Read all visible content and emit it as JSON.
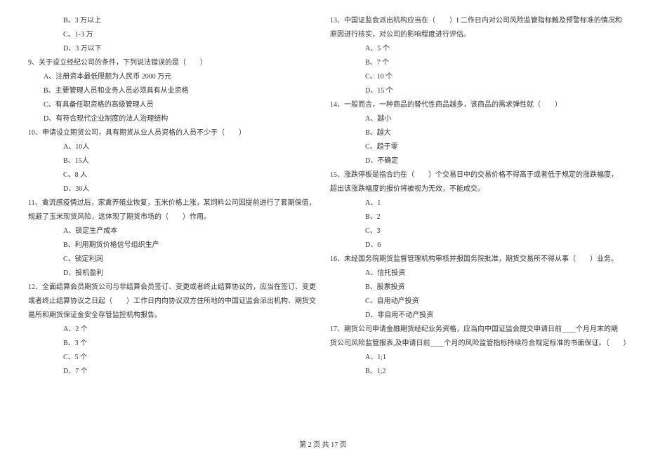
{
  "leftColumn": {
    "options8": {
      "b": "B、3 万以上",
      "c": "C、1-3 万",
      "d": "D、3 万以下"
    },
    "q9": {
      "text": "9、关于设立经纪公司的条件，下列说法错误的是（　　）",
      "a": "A、注册资本最低限额为人民币 2000 万元",
      "b": "B、主要管理人员和业务人员必须具有从业资格",
      "c": "C、有具备任职资格的高级管理人员",
      "d": "D、有符合现代企业制度的法人治理结构"
    },
    "q10": {
      "text": "10、申请设立期货公司，具有期货从业人员资格的人员不少于（　　）",
      "a": "A、10人",
      "b": "B、15人",
      "c": "C、8 人",
      "d": "D、30人"
    },
    "q11": {
      "text1": "11、禽流感疫情过后，家禽养殖业恢复，玉米价格上涨，某饲料公司因提前进行了套期保值，",
      "text2": "规避了玉米现货风险，这体现了期货市场的（　　）作用。",
      "a": "A、锁定生产成本",
      "b": "B、利用期货价格信号组织生产",
      "c": "C、锁定利润",
      "d": "D、投机盈利"
    },
    "q12": {
      "text1": "12、全面结算会员期货公司与非结算会员签订、变更或者终止结算协议的，应当在签订、变更",
      "text2": "或者终止结算协议之日起（　　）工作日内向协议双方住所地的中国证监会派出机构、期货交",
      "text3": "易所和期货保证金安全存管监控机构报告。",
      "a": "A、2 个",
      "b": "B、3 个",
      "c": "C、5 个",
      "d": "D、7 个"
    }
  },
  "rightColumn": {
    "q13": {
      "text1": "13、中国证监会派出机构应当在（　　）I 二作日内对公司风险监管指标触及预警标准的情况和",
      "text2": "原因进行核实，对公司的影响程度进行评估。",
      "a": "A、5 个",
      "b": "B、7 个",
      "c": "C、10 个",
      "d": "D、15 个"
    },
    "q14": {
      "text": "14、一般而言，一种商品的替代性商品越多，该商品的需求弹性就（　　）",
      "a": "A、越小",
      "b": "B、越大",
      "c": "C、趋于零",
      "d": "D、不确定"
    },
    "q15": {
      "text1": "15、涨跌停板是指合约在（　　）个交易日中的交易价格不得高于或者低于规定的涨跌幅度，",
      "text2": "超出该涨跌幅度的报价将被视为无效，不能成交。",
      "a": "A、1",
      "b": "B、2",
      "c": "C、3",
      "d": "D、6"
    },
    "q16": {
      "text": "16、未经国务院期货监督管理机构审核并报国务院批准，期货交易所不得从事（　　）业务。",
      "a": "A、信托投资",
      "b": "B、股票投资",
      "c": "C、自用动产投资",
      "d": "D、非自用不动产投资"
    },
    "q17": {
      "text1": "17、期货公司申请金融期货经纪业务资格，应当向中国证监会提交申请日前____个月月末的期",
      "text2": "货公司风险监管报表,及申请日前____个月的风险监管指标持续符合规定标准的书面保证。（　　）",
      "a": "A、1;1",
      "b": "B、1;2"
    }
  },
  "footer": "第 2 页 共 17 页"
}
